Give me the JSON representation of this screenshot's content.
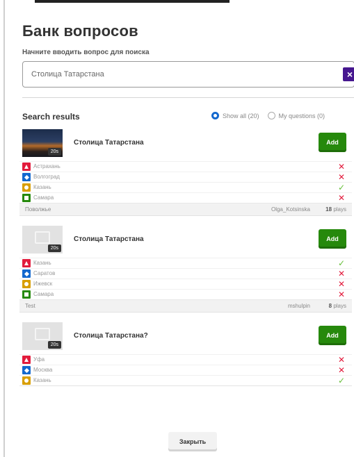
{
  "modal": {
    "title": "Банк вопросов",
    "search_hint": "Начните вводить вопрос для поиска",
    "search_value": "Столица Татарстана",
    "clear_icon": "x-icon",
    "results_label": "Search results",
    "filter": {
      "show_all": "Show all (20)",
      "my_questions": "My questions (0)",
      "selected": "show_all"
    },
    "close_label": "Закрыть"
  },
  "results": [
    {
      "title": "Столица Татарстана",
      "time": "20s",
      "thumb": "photo",
      "add_label": "Add",
      "answers": [
        {
          "text": "Астрахань",
          "color": "red",
          "correct": false
        },
        {
          "text": "Волгоград",
          "color": "blue",
          "correct": false
        },
        {
          "text": "Казань",
          "color": "yellow",
          "correct": true
        },
        {
          "text": "Самара",
          "color": "green",
          "correct": false
        }
      ],
      "footer": {
        "quiz": "Поволжье",
        "author": "Olga_Kotsinska",
        "plays_num": "18",
        "plays_word": "plays"
      }
    },
    {
      "title": "Столица Татарстана",
      "time": "20s",
      "thumb": "placeholder",
      "add_label": "Add",
      "answers": [
        {
          "text": "Казань",
          "color": "red",
          "correct": true
        },
        {
          "text": "Саратов",
          "color": "blue",
          "correct": false
        },
        {
          "text": "Ижевск",
          "color": "yellow",
          "correct": false
        },
        {
          "text": "Самара",
          "color": "green",
          "correct": false
        }
      ],
      "footer": {
        "quiz": "Test",
        "author": "mshulpin",
        "plays_num": "8",
        "plays_word": "plays"
      }
    },
    {
      "title": "Столица Татарстана?",
      "time": "20s",
      "thumb": "placeholder",
      "add_label": "Add",
      "answers": [
        {
          "text": "Уфа",
          "color": "red",
          "correct": false
        },
        {
          "text": "Москва",
          "color": "blue",
          "correct": false
        },
        {
          "text": "Казань",
          "color": "yellow",
          "correct": true
        }
      ]
    }
  ],
  "colors": {
    "add_green": "#26890c",
    "red": "#e21b3c",
    "blue": "#1368ce",
    "yellow": "#d89e00",
    "green": "#26890c",
    "clear_purple": "#46178f"
  }
}
